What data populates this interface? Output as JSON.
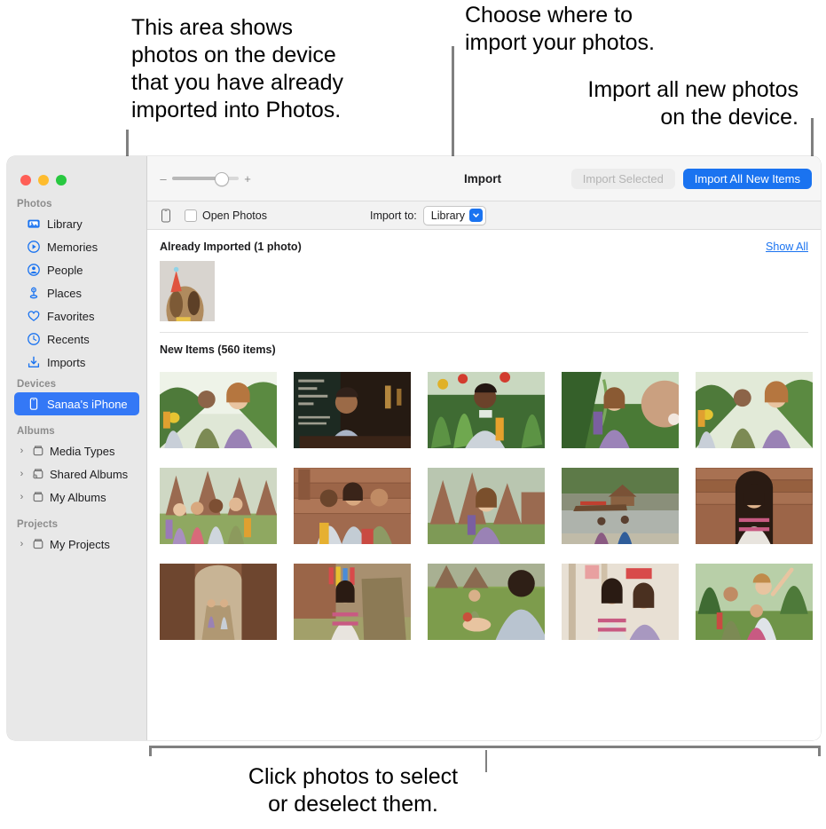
{
  "callouts": [
    {
      "id": "callout-1",
      "text": "This area shows\nphotos on the device\nthat you have already\nimported into Photos."
    },
    {
      "id": "callout-2",
      "text": "Choose where to\nimport your photos."
    },
    {
      "id": "callout-3",
      "text": "Import all new photos\non the device."
    },
    {
      "id": "callout-4",
      "text": "Click photos to select\nor deselect them."
    }
  ],
  "window": {
    "sidebar": {
      "sections": [
        {
          "title": "Photos",
          "items": [
            {
              "label": "Library",
              "icon": "library-icon",
              "selected": false,
              "twisty": false
            },
            {
              "label": "Memories",
              "icon": "memories-icon",
              "selected": false,
              "twisty": false
            },
            {
              "label": "People",
              "icon": "people-icon",
              "selected": false,
              "twisty": false
            },
            {
              "label": "Places",
              "icon": "places-icon",
              "selected": false,
              "twisty": false
            },
            {
              "label": "Favorites",
              "icon": "favorites-icon",
              "selected": false,
              "twisty": false
            },
            {
              "label": "Recents",
              "icon": "recents-icon",
              "selected": false,
              "twisty": false
            },
            {
              "label": "Imports",
              "icon": "imports-icon",
              "selected": false,
              "twisty": false
            }
          ]
        },
        {
          "title": "Devices",
          "items": [
            {
              "label": "Sanaa's iPhone",
              "icon": "iphone-icon",
              "selected": true,
              "twisty": false
            }
          ]
        },
        {
          "title": "Albums",
          "items": [
            {
              "label": "Media Types",
              "icon": "album-icon",
              "selected": false,
              "twisty": true
            },
            {
              "label": "Shared Albums",
              "icon": "shared-album-icon",
              "selected": false,
              "twisty": true
            },
            {
              "label": "My Albums",
              "icon": "album-icon",
              "selected": false,
              "twisty": true
            }
          ]
        },
        {
          "title": "Projects",
          "items": [
            {
              "label": "My Projects",
              "icon": "album-icon",
              "selected": false,
              "twisty": true
            }
          ]
        }
      ]
    },
    "toolbar": {
      "zoom_minus": "–",
      "zoom_plus": "+",
      "zoom_percent": 72,
      "title": "Import",
      "import_selected_label": "Import Selected",
      "import_selected_enabled": false,
      "import_all_label": "Import All New Items",
      "accent_color": "#1a73f0"
    },
    "subbar": {
      "open_photos_label": "Open Photos",
      "open_photos_checked": false,
      "import_to_label": "Import to:",
      "import_to_value": "Library"
    },
    "content": {
      "already_imported": {
        "heading": "Already Imported (1 photo)",
        "show_all_label": "Show All",
        "thumbs": [
          "dog-party-hat"
        ]
      },
      "new_items": {
        "heading": "New Items (560 items)",
        "thumbs": [
          "two-travelers-path",
          "man-cafe-chalkboard",
          "man-red-flowers",
          "woman-backpack-green",
          "travelers-path-2",
          "group-four-temple",
          "three-friends-ruins",
          "woman-temple-walk",
          "riverside-boat",
          "woman-temple-arch",
          "couple-ruins-alley",
          "woman-tree-ribbons",
          "picnic-grass",
          "two-women-market",
          "friends-cheering"
        ]
      }
    }
  }
}
